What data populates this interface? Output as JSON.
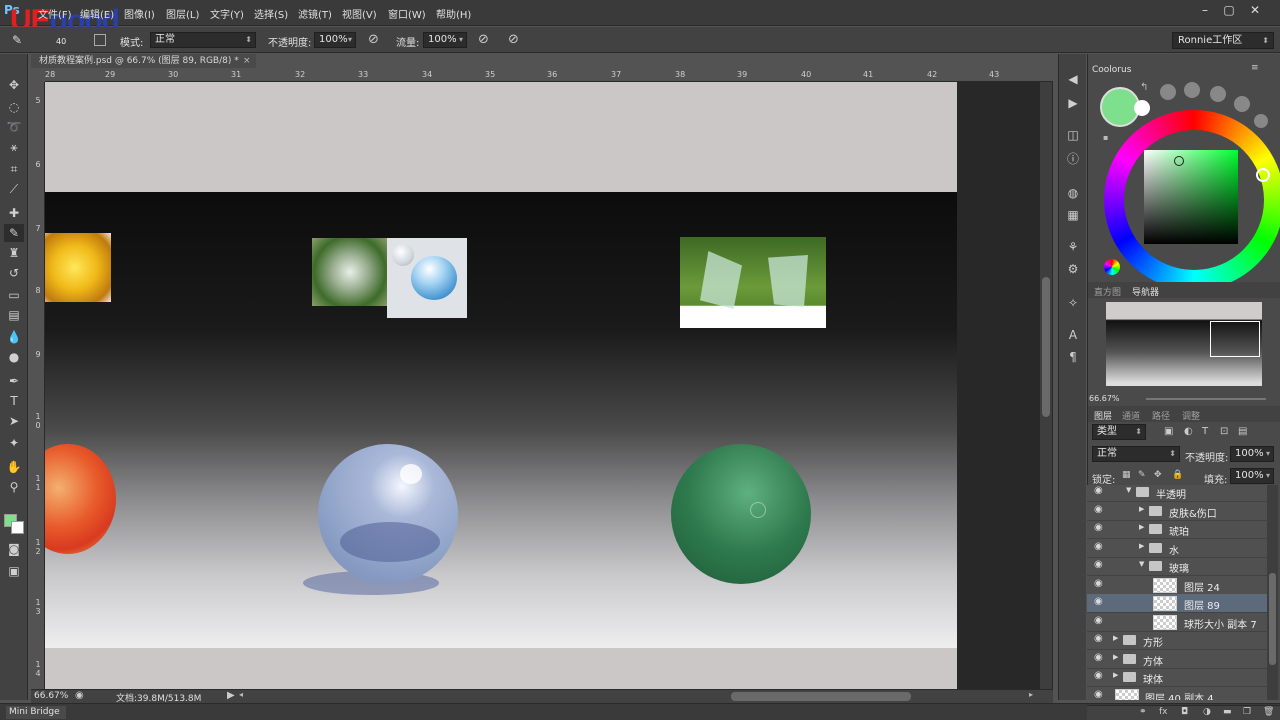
{
  "menubar": {
    "items": [
      "文件(F)",
      "编辑(E)",
      "图像(I)",
      "图层(L)",
      "文字(Y)",
      "选择(S)",
      "滤镜(T)",
      "视图(V)",
      "窗口(W)",
      "帮助(H)"
    ],
    "logo": "Ps",
    "watermark_a": "UE",
    "watermark_b": "good"
  },
  "options": {
    "brush_size": "40",
    "mode_label": "模式:",
    "mode_value": "正常",
    "opacity_label": "不透明度:",
    "opacity_value": "100%",
    "flow_label": "流量:",
    "flow_value": "100%",
    "workspace": "Ronnie工作区"
  },
  "document": {
    "tab_title": "材质教程案例.psd @ 66.7% (图层 89, RGB/8) *",
    "zoom": "66.67%",
    "doc_size": "文档:39.8M/513.8M",
    "ruler_top": [
      "28",
      "29",
      "30",
      "31",
      "32",
      "33",
      "34",
      "35",
      "36",
      "37",
      "38",
      "39",
      "40",
      "41",
      "42",
      "43"
    ],
    "ruler_left": [
      "5",
      "6",
      "7",
      "8",
      "9",
      "1 0",
      "1 1",
      "1 2",
      "1 3",
      "1 4"
    ]
  },
  "bottom_bar": {
    "mini_bridge": "Mini Bridge"
  },
  "panels": {
    "coolorus_title": "Coolorus",
    "picker_color": "#7ee08c",
    "histogram_tab": "直方图",
    "navigator_tab": "导航器",
    "nav_zoom": "66.67%",
    "layers_tabs": [
      "图层",
      "通道",
      "路径",
      "调整"
    ],
    "filter_kind": "类型",
    "blend_mode": "正常",
    "opacity_label": "不透明度:",
    "opacity_value": "100%",
    "lock_label": "锁定:",
    "fill_label": "填充:",
    "fill_value": "100%",
    "layers": [
      {
        "name": "半透明",
        "type": "group-open"
      },
      {
        "name": "皮肤&伤口",
        "type": "group"
      },
      {
        "name": "琥珀",
        "type": "group"
      },
      {
        "name": "水",
        "type": "group"
      },
      {
        "name": "玻璃",
        "type": "group-open"
      },
      {
        "name": "图层 24",
        "type": "layer"
      },
      {
        "name": "图层 89",
        "type": "layer",
        "selected": true
      },
      {
        "name": "球形大小 副本 7",
        "type": "layer"
      },
      {
        "name": "方形",
        "type": "group"
      },
      {
        "name": "方体",
        "type": "group"
      },
      {
        "name": "球体",
        "type": "group"
      },
      {
        "name": "图层 40 副本 4",
        "type": "layer"
      }
    ]
  },
  "colors": {
    "foreground": "#7ee08c",
    "background": "#ffffff",
    "glass_sphere": "#8fa3c8",
    "green_sphere": "#2f7a4e",
    "orange_sphere": "#e85a2a"
  }
}
